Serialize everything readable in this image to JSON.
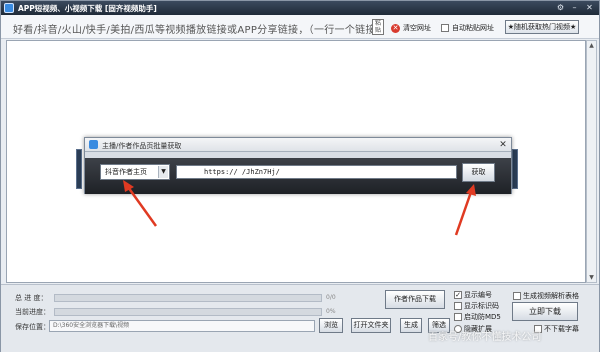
{
  "titlebar": {
    "title": "APP短视频、小视频下载 [固齐视频助手]",
    "settings_icon": "gear-icon",
    "minimize_icon": "minimize-icon",
    "close_icon": "close-icon"
  },
  "toolbar": {
    "hint": "好看/抖音/火山/快手/美拍/西瓜等视频播放链接或APP分享链接，（一行一个链接）",
    "paste_label": "粘贴",
    "clear_label": "清空网址",
    "auto_paste_label": "自动粘贴网址",
    "random_button": "★随机获取热门视频★"
  },
  "input_area": {
    "value": ""
  },
  "dialog": {
    "title": "主播/作者作品页批量获取",
    "close_symbol": "✕",
    "mode_select": "抖音作者主页",
    "url_value": "https://          /JhZn7Hj/",
    "get_button": "获取"
  },
  "bottom": {
    "total_progress_label": "总 进 度：",
    "total_progress_value": "0/0",
    "current_progress_label": "当前进度：",
    "current_progress_value": "0%",
    "save_label": "保存位置：",
    "save_path": "D:\\360安全浏览器下载\\视频",
    "browse_button": "浏览",
    "open_folder_button": "打开文件夹",
    "author_download_button": "作者作品下载",
    "generate_button": "生成",
    "select_button": "筛选",
    "show_number_label": "显示编号",
    "show_tags_label": "显示标识码",
    "auto_md5_label": "启动防MD5",
    "auto_hide_label": "隐藏扩展",
    "gen_table_label": "生成视频解析表格",
    "download_now_button": "立即下载",
    "no_subtitle_label": "不下载字幕"
  },
  "watermark": "百家号/教你不懂技术公司",
  "colors": {
    "titlebar": "#1f2a38",
    "dialog_panel": "#2a2e34",
    "annotation_arrow": "#e03a22",
    "clear_icon": "#d83a2e"
  }
}
